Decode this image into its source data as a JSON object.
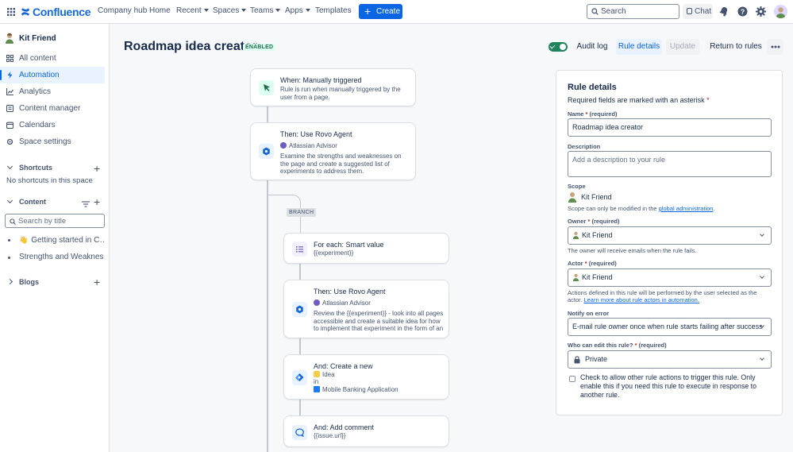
{
  "topbar": {
    "logo_text": "Confluence",
    "nav": [
      {
        "label": "Company hub",
        "caret": false
      },
      {
        "label": "Home",
        "caret": false
      },
      {
        "label": "Recent",
        "caret": true
      },
      {
        "label": "Spaces",
        "caret": true
      },
      {
        "label": "Teams",
        "caret": true
      },
      {
        "label": "Apps",
        "caret": true
      },
      {
        "label": "Templates",
        "caret": false
      }
    ],
    "create_label": "Create",
    "search_placeholder": "Search",
    "chat_label": "Chat"
  },
  "sidebar": {
    "user_name": "Kit Friend",
    "items": [
      {
        "label": "All content",
        "icon": "grid-icon"
      },
      {
        "label": "Automation",
        "icon": "lightning-icon",
        "active": true
      },
      {
        "label": "Analytics",
        "icon": "chart-icon"
      },
      {
        "label": "Content manager",
        "icon": "content-icon"
      },
      {
        "label": "Calendars",
        "icon": "calendar-icon"
      },
      {
        "label": "Space settings",
        "icon": "gear-icon"
      }
    ],
    "shortcuts_label": "Shortcuts",
    "no_shortcuts": "No shortcuts in this space",
    "content_label": "Content",
    "search_title_placeholder": "Search by title",
    "tree": [
      {
        "label": "Getting started in C…",
        "emoji": "👋"
      },
      {
        "label": "Strengths and Weaknes…"
      }
    ],
    "blogs_label": "Blogs"
  },
  "rule": {
    "title": "Roadmap idea creator",
    "status": "ENABLED",
    "audit_log": "Audit log",
    "rule_details": "Rule details",
    "update": "Update",
    "return_to_rules": "Return to rules"
  },
  "flow": {
    "trigger": {
      "title": "When: Manually triggered",
      "desc": "Rule is run when manually triggered by the user from a page."
    },
    "action1": {
      "title": "Then: Use Rovo Agent",
      "agent": "Atlassian Advisor",
      "desc": "Examine the strengths and weaknesses on the page and create a suggested list of experiments to address them."
    },
    "branch_label": "BRANCH",
    "foreach": {
      "title": "For each: Smart value",
      "value": "{{experiment}}"
    },
    "action2": {
      "title": "Then: Use Rovo Agent",
      "agent": "Atlassian Advisor",
      "desc": "Review the {{experiment}} - look into all pages accessible and create a suitable idea for how to implement that experiment in the form of an ep…"
    },
    "create": {
      "title": "And: Create a new",
      "type": "Idea",
      "in": "in",
      "project": "Mobile Banking Application"
    },
    "comment": {
      "title": "And: Add comment",
      "value": "{{issue.url}}"
    }
  },
  "panel": {
    "heading": "Rule details",
    "required_note": "Required fields are marked with an asterisk",
    "name_label": "Name",
    "required_suffix": "(required)",
    "name_value": "Roadmap idea creator",
    "desc_label": "Description",
    "desc_placeholder": "Add a description to your rule",
    "scope_label": "Scope",
    "scope_value": "Kit Friend",
    "scope_help": "Scope can only be modified in the",
    "scope_link": "global administration",
    "owner_label": "Owner",
    "owner_value": "Kit Friend",
    "owner_help": "The owner will receive emails when the rule fails.",
    "actor_label": "Actor",
    "actor_value": "Kit Friend",
    "actor_help": "Actions defined in this rule will be performed by the user selected as the actor.",
    "actor_link": "Learn more about rule actors in automation.",
    "notify_label": "Notify on error",
    "notify_value": "E-mail rule owner once when rule starts failing after success",
    "edit_label": "Who can edit this rule?",
    "edit_value": "Private",
    "checkbox_text": "Check to allow other rule actions to trigger this rule. Only enable this if you need this rule to execute in response to another rule."
  }
}
